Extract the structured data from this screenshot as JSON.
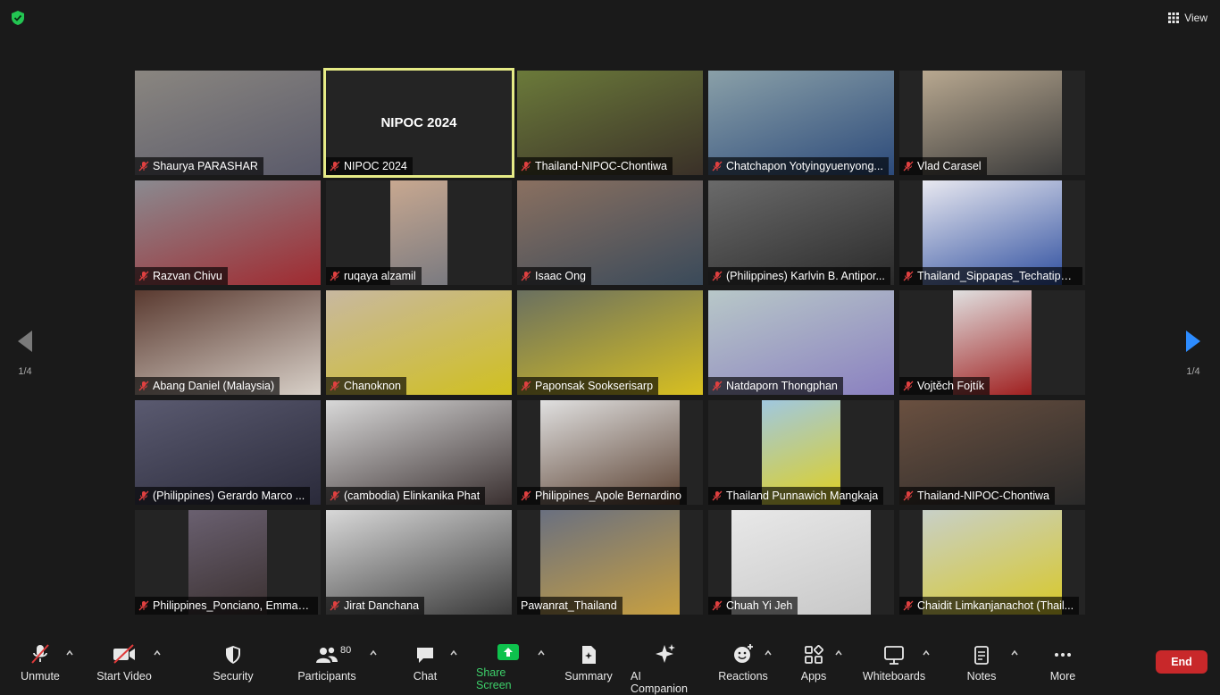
{
  "top": {
    "view_label": "View"
  },
  "active_tile_title": "NIPOC 2024",
  "participants": [
    {
      "name": "Shaurya PARASHAR",
      "c1": "#8a8680",
      "c2": "#5a5a6a"
    },
    {
      "name": "NIPOC 2024",
      "c1": "#242424",
      "c2": "#242424"
    },
    {
      "name": "Thailand-NIPOC-Chontiwa",
      "c1": "#6b7a3a",
      "c2": "#3a3028"
    },
    {
      "name": "Chatchapon Yotyingyuenyong...",
      "c1": "#8aa0a8",
      "c2": "#2c4a7a"
    },
    {
      "name": "Vlad Carasel",
      "c1": "#b8a890",
      "c2": "#3a3a3a"
    },
    {
      "name": "Razvan Chivu",
      "c1": "#8a8a90",
      "c2": "#a02a30"
    },
    {
      "name": "ruqaya alzamil",
      "c1": "#c8a890",
      "c2": "#7a7a80"
    },
    {
      "name": "Isaac Ong",
      "c1": "#8a7060",
      "c2": "#3a4a5a"
    },
    {
      "name": "(Philippines) Karlvin B. Antipor...",
      "c1": "#6a6a6a",
      "c2": "#2a2a2a"
    },
    {
      "name": "Thailand_Sippapas_Techatipak...",
      "c1": "#e8e8f0",
      "c2": "#3050a0"
    },
    {
      "name": "Abang Daniel (Malaysia)",
      "c1": "#5a3a30",
      "c2": "#d8d0c8"
    },
    {
      "name": "Chanoknon",
      "c1": "#c8b8a0",
      "c2": "#d0c020"
    },
    {
      "name": "Paponsak Sookserisarp",
      "c1": "#6a7060",
      "c2": "#d8c020"
    },
    {
      "name": "Natdaporn Thongphan",
      "c1": "#b8c8c8",
      "c2": "#8a80c0"
    },
    {
      "name": "Vojtěch Fojtík",
      "c1": "#e0e0e0",
      "c2": "#a02020"
    },
    {
      "name": "(Philippines) Gerardo Marco ...",
      "c1": "#5a5a70",
      "c2": "#2a2a3a"
    },
    {
      "name": "(cambodia) Elinkanika Phat",
      "c1": "#d8d8d8",
      "c2": "#3a3030"
    },
    {
      "name": "Philippines_Apole Bernardino",
      "c1": "#e0e0e0",
      "c2": "#5a4030"
    },
    {
      "name": "Thailand Punnawich Mangkaja",
      "c1": "#a0c8e0",
      "c2": "#e0d020"
    },
    {
      "name": "Thailand-NIPOC-Chontiwa",
      "c1": "#6a5040",
      "c2": "#2a2a2a"
    },
    {
      "name": "Philippines_Ponciano, Emman...",
      "c1": "#6a6070",
      "c2": "#3a3030"
    },
    {
      "name": "Jirat Danchana",
      "c1": "#d8d8d8",
      "c2": "#3a3a3a"
    },
    {
      "name": "Pawanrat_Thailand",
      "c1": "#6a7080",
      "c2": "#c8a040"
    },
    {
      "name": "Chuah Yi Jeh",
      "c1": "#e8e8e8",
      "c2": "#c8c8c8"
    },
    {
      "name": "Chaidit Limkanjanachot (Thail...",
      "c1": "#c8d0c8",
      "c2": "#d8c828"
    }
  ],
  "nav": {
    "left_page": "1/4",
    "right_page": "1/4"
  },
  "toolbar": {
    "unmute": "Unmute",
    "start_video": "Start Video",
    "security": "Security",
    "participants": "Participants",
    "participants_count": "80",
    "chat": "Chat",
    "share_screen": "Share Screen",
    "summary": "Summary",
    "ai_companion": "AI Companion",
    "reactions": "Reactions",
    "apps": "Apps",
    "whiteboards": "Whiteboards",
    "notes": "Notes",
    "more": "More",
    "end": "End"
  },
  "colors": {
    "active_border": "#e6eb86",
    "share_green": "#0ec24d",
    "end_red": "#c8282a",
    "nav_arrow": "#2d8cff"
  }
}
